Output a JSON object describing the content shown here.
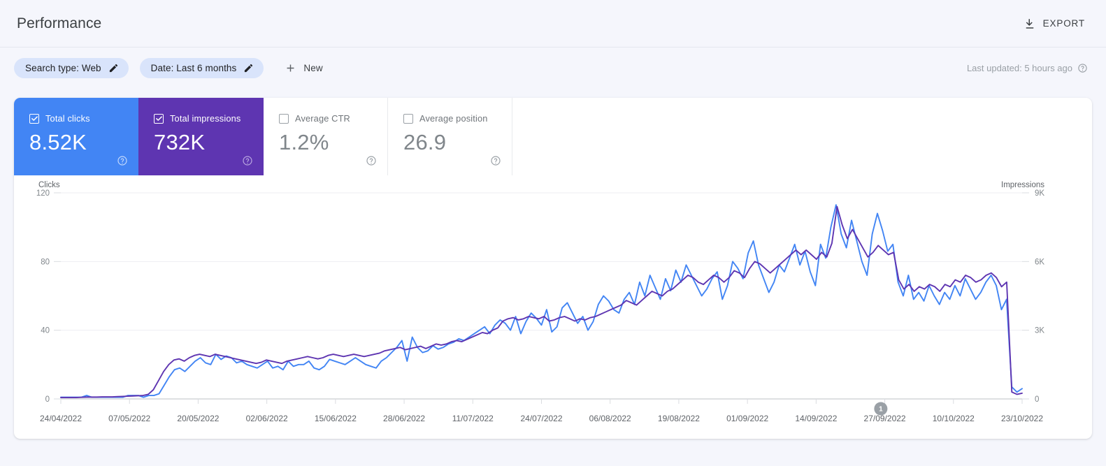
{
  "header": {
    "title": "Performance",
    "export_label": "EXPORT",
    "export_icon": "download-icon"
  },
  "filters": {
    "chips": [
      {
        "label": "Search type: Web",
        "icon": "pencil-icon"
      },
      {
        "label": "Date: Last 6 months",
        "icon": "pencil-icon"
      }
    ],
    "new_button": {
      "label": "New",
      "icon": "plus-icon"
    },
    "last_updated": "Last updated: 5 hours ago",
    "help_icon": "help-circle-icon"
  },
  "metric_cards": [
    {
      "label": "Total clicks",
      "value": "8.52K",
      "checked": true,
      "color": "#4285F4",
      "help_icon": "help-circle-icon"
    },
    {
      "label": "Total impressions",
      "value": "732K",
      "checked": true,
      "color": "#5E35B1",
      "help_icon": "help-circle-icon"
    },
    {
      "label": "Average CTR",
      "value": "1.2%",
      "checked": false,
      "color": "#80868B",
      "help_icon": "help-circle-icon"
    },
    {
      "label": "Average position",
      "value": "26.9",
      "checked": false,
      "color": "#80868B",
      "help_icon": "help-circle-icon"
    }
  ],
  "annotations": [
    {
      "number": "1",
      "x_ratio": 0.853
    }
  ],
  "chart_data": {
    "type": "line",
    "title": "",
    "xlabel": "",
    "grid": true,
    "legend": "metric-cards",
    "y_left": {
      "label": "Clicks",
      "ticks": [
        0,
        40,
        80,
        120
      ],
      "tick_labels": [
        "0",
        "40",
        "80",
        "120"
      ],
      "range": [
        0,
        120
      ],
      "color": "#4285F4"
    },
    "y_right": {
      "label": "Impressions",
      "ticks": [
        0,
        3000,
        6000,
        9000
      ],
      "tick_labels": [
        "0",
        "3K",
        "6K",
        "9K"
      ],
      "range": [
        0,
        9000
      ],
      "color": "#5E35B1"
    },
    "x_tick_labels": [
      "24/04/2022",
      "07/05/2022",
      "20/05/2022",
      "02/06/2022",
      "15/06/2022",
      "28/06/2022",
      "11/07/2022",
      "24/07/2022",
      "06/08/2022",
      "19/08/2022",
      "01/09/2022",
      "14/09/2022",
      "27/09/2022",
      "10/10/2022",
      "23/10/2022"
    ],
    "x_start": "24/04/2022",
    "x_end": "23/10/2022",
    "n_points": 183,
    "series": [
      {
        "name": "Total clicks",
        "color": "#4285F4",
        "axis": "left",
        "unit": "clicks",
        "values": [
          1,
          1,
          1,
          1,
          1,
          2,
          1,
          1,
          1,
          1,
          1,
          1,
          1,
          2,
          2,
          2,
          1,
          2,
          2,
          3,
          8,
          13,
          17,
          18,
          16,
          19,
          22,
          24,
          21,
          20,
          26,
          23,
          25,
          24,
          21,
          22,
          20,
          19,
          18,
          20,
          22,
          18,
          19,
          17,
          22,
          19,
          20,
          20,
          22,
          18,
          17,
          19,
          23,
          22,
          21,
          20,
          22,
          24,
          22,
          20,
          19,
          18,
          22,
          24,
          27,
          30,
          34,
          22,
          36,
          30,
          27,
          28,
          31,
          29,
          30,
          32,
          33,
          35,
          34,
          36,
          38,
          40,
          42,
          38,
          43,
          46,
          44,
          40,
          48,
          38,
          45,
          50,
          47,
          43,
          52,
          39,
          42,
          53,
          56,
          50,
          44,
          48,
          40,
          45,
          55,
          60,
          57,
          52,
          50,
          58,
          62,
          55,
          68,
          60,
          72,
          65,
          58,
          70,
          63,
          75,
          68,
          78,
          72,
          66,
          60,
          64,
          70,
          74,
          58,
          66,
          80,
          76,
          70,
          85,
          92,
          78,
          70,
          62,
          68,
          78,
          74,
          82,
          90,
          78,
          86,
          74,
          66,
          90,
          82,
          100,
          113,
          96,
          88,
          104,
          92,
          80,
          72,
          96,
          108,
          98,
          86,
          90,
          68,
          60,
          72,
          58,
          62,
          57,
          66,
          60,
          55,
          62,
          58,
          66,
          60,
          70,
          64,
          58,
          62,
          68,
          72,
          66,
          52,
          58,
          7,
          4,
          6
        ]
      },
      {
        "name": "Total impressions",
        "color": "#5E35B1",
        "axis": "right",
        "unit": "impressions",
        "values": [
          60,
          60,
          60,
          60,
          70,
          80,
          80,
          80,
          90,
          90,
          90,
          100,
          110,
          120,
          130,
          140,
          150,
          200,
          400,
          800,
          1200,
          1500,
          1700,
          1750,
          1650,
          1800,
          1900,
          1950,
          1900,
          1850,
          1950,
          1900,
          1850,
          1800,
          1750,
          1700,
          1650,
          1600,
          1550,
          1600,
          1700,
          1650,
          1600,
          1550,
          1650,
          1700,
          1750,
          1800,
          1850,
          1800,
          1750,
          1800,
          1900,
          1950,
          1900,
          1850,
          1900,
          1950,
          1900,
          1850,
          1900,
          1950,
          2000,
          2100,
          2150,
          2200,
          2250,
          2150,
          2200,
          2250,
          2300,
          2200,
          2300,
          2400,
          2350,
          2400,
          2500,
          2550,
          2500,
          2600,
          2700,
          2800,
          2900,
          2850,
          3000,
          3100,
          3400,
          3500,
          3550,
          3450,
          3500,
          3600,
          3550,
          3500,
          3600,
          3400,
          3450,
          3550,
          3600,
          3500,
          3400,
          3500,
          3450,
          3550,
          3600,
          3700,
          3800,
          3900,
          4000,
          4100,
          4300,
          4200,
          4100,
          4300,
          4500,
          4700,
          4600,
          4500,
          4700,
          4800,
          5000,
          5200,
          5400,
          5300,
          5100,
          5000,
          5200,
          5400,
          5300,
          5100,
          5300,
          5600,
          5500,
          5300,
          5700,
          6000,
          5900,
          5700,
          5500,
          5700,
          5900,
          6100,
          6300,
          6500,
          6300,
          6500,
          6300,
          6100,
          6400,
          6200,
          6800,
          8400,
          7600,
          7000,
          7400,
          7000,
          6600,
          6200,
          6400,
          6700,
          6500,
          6300,
          6400,
          5200,
          4800,
          5000,
          4700,
          4900,
          4800,
          5000,
          4900,
          4700,
          5000,
          4900,
          5200,
          5100,
          5400,
          5300,
          5100,
          5200,
          5400,
          5500,
          5300,
          4900,
          5100,
          300,
          200,
          250
        ]
      }
    ]
  }
}
